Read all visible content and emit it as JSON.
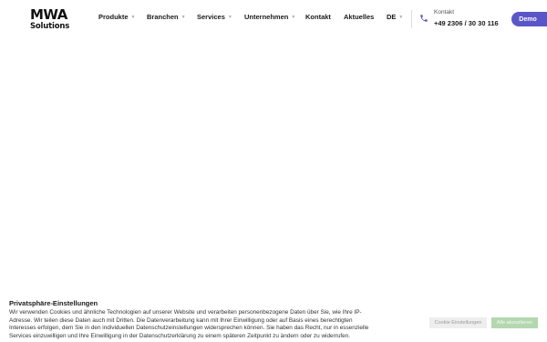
{
  "logo": {
    "line1": "MWA",
    "line2": "Solutions"
  },
  "nav": {
    "items": [
      {
        "label": "Produkte",
        "caret": "▼"
      },
      {
        "label": "Branchen",
        "caret": "▼"
      },
      {
        "label": "Services",
        "caret": "▼"
      },
      {
        "label": "Unternehmen",
        "caret": "▼"
      },
      {
        "label": "Kontakt"
      },
      {
        "label": "Aktuelles"
      },
      {
        "label": "DE",
        "caret": "▼"
      }
    ]
  },
  "contact": {
    "label": "Kontakt",
    "phone": "+49 2306 / 30 30 116",
    "icon": "phone-icon"
  },
  "demo_button": {
    "label": "Demo"
  },
  "cookie": {
    "title": "Privatsphäre-Einstellungen",
    "text": "Wir verwenden Cookies und ähnliche Technologien auf unserer Website und verarbeiten personenbezogene Daten über Sie, wie Ihre IP-Adresse. Wir teilen diese Daten auch mit Dritten. Die Datenverarbeitung kann mit Ihrer Einwilligung oder auf Basis eines berechtigten Interesses erfolgen, dem Sie in den individuellen Datenschutzeinstellungen widersprechen können. Sie haben das Recht, nur in essenzielle Services einzuwilligen und Ihre Einwilligung in der Datenschutzerklärung zu einem späteren Zeitpunkt zu ändern oder zu widerrufen.",
    "settings_label": "Cookie Einstellungen",
    "accept_label": "Alle akzeptieren"
  },
  "colors": {
    "accent": "#5b56c8",
    "accept": "#b3d8b0"
  }
}
